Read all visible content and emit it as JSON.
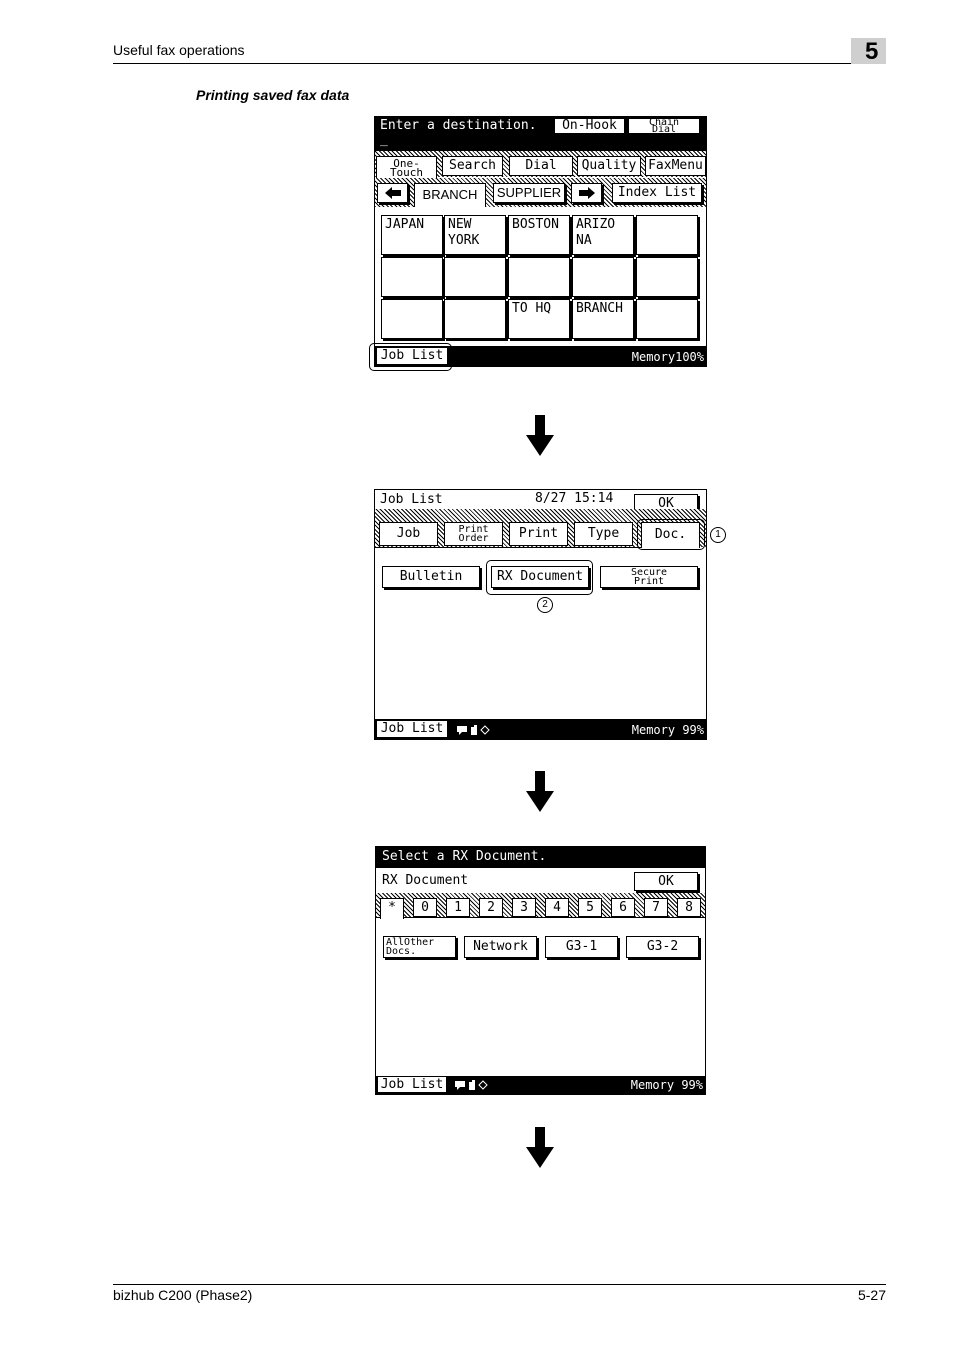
{
  "header": {
    "section": "Useful fax operations",
    "chapter": "5"
  },
  "caption": "Printing saved fax data",
  "screen1": {
    "prompt": "Enter a destination.",
    "cursor": "_",
    "on_hook": "On-Hook",
    "chain_dial": "Chain\nDial",
    "tabs": [
      "One-\nTouch",
      "Search",
      "Dial",
      "Quality",
      "FaxMenu"
    ],
    "nav": {
      "left_arrow": "←",
      "branch": "BRANCH",
      "supplier": "SUPPLIER",
      "right_arrow": "→",
      "index_list": "Index List"
    },
    "cells": [
      "JAPAN",
      "NEW\nYORK",
      "BOSTON",
      "ARIZO\nNA",
      "",
      "",
      "",
      "",
      "",
      "",
      "",
      "",
      "TO HQ",
      "BRANCH",
      ""
    ],
    "job_list": "Job List",
    "memory": "Memory100%"
  },
  "screen2": {
    "title": "Job List",
    "datetime": "8/27 15:14",
    "ok": "OK",
    "tabs": [
      "Job",
      "Print\nOrder",
      "Print",
      "Type",
      "Doc."
    ],
    "buttons": [
      "Bulletin",
      "RX Document",
      "Secure\nPrint"
    ],
    "callout1": "1",
    "callout2": "2",
    "job_list": "Job List",
    "memory": "Memory 99%"
  },
  "screen3": {
    "prompt": "Select a RX Document.",
    "title": "RX Document",
    "ok": "OK",
    "index_tabs": [
      "*",
      "0",
      "1",
      "2",
      "3",
      "4",
      "5",
      "6",
      "7",
      "8"
    ],
    "buttons": [
      "AllOther\nDocs.",
      "Network",
      "G3-1",
      "G3-2"
    ],
    "job_list": "Job List",
    "memory": "Memory 99%"
  },
  "footer": {
    "product": "bizhub C200 (Phase2)",
    "page": "5-27"
  },
  "icons": {
    "step_arrow": "down-arrow-icon",
    "status": "status-icons"
  }
}
